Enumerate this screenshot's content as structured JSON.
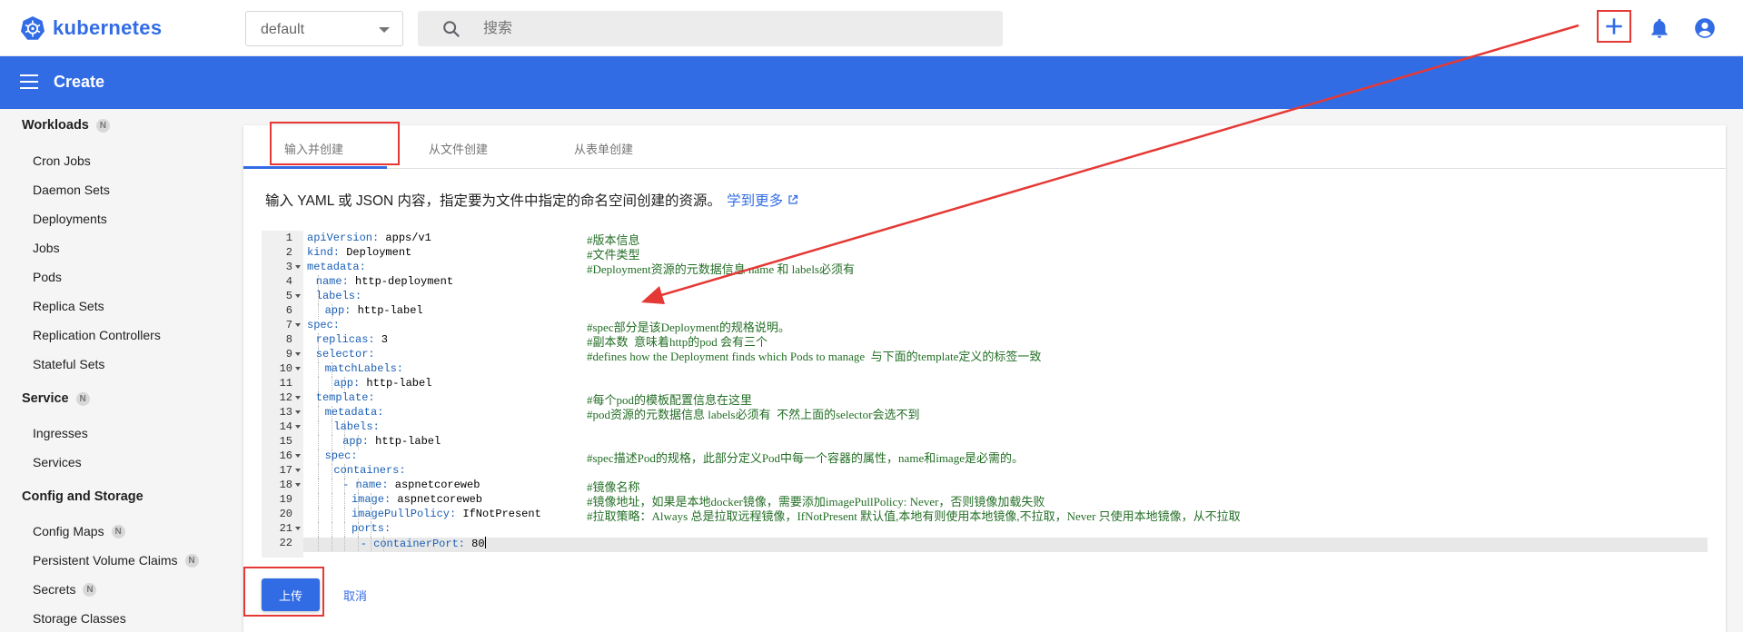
{
  "app": {
    "brand": "kubernetes",
    "accent": "#326ce5",
    "annotation_color": "#e53935"
  },
  "namespace": {
    "value": "default"
  },
  "search": {
    "placeholder": "搜索"
  },
  "toolbar": {
    "create_icon": "plus-icon",
    "notifications_icon": "bell-icon",
    "account_icon": "account-circle-icon"
  },
  "header": {
    "title": "Create"
  },
  "sidebar": {
    "sections": [
      {
        "label": "Workloads",
        "badge": "N",
        "items": [
          {
            "label": "Cron Jobs"
          },
          {
            "label": "Daemon Sets"
          },
          {
            "label": "Deployments"
          },
          {
            "label": "Jobs"
          },
          {
            "label": "Pods"
          },
          {
            "label": "Replica Sets"
          },
          {
            "label": "Replication Controllers"
          },
          {
            "label": "Stateful Sets"
          }
        ]
      },
      {
        "label": "Service",
        "badge": "N",
        "items": [
          {
            "label": "Ingresses"
          },
          {
            "label": "Services"
          }
        ]
      },
      {
        "label": "Config and Storage",
        "items": [
          {
            "label": "Config Maps",
            "badge": "N"
          },
          {
            "label": "Persistent Volume Claims",
            "badge": "N"
          },
          {
            "label": "Secrets",
            "badge": "N"
          },
          {
            "label": "Storage Classes"
          }
        ]
      }
    ]
  },
  "tabs": [
    {
      "label": "输入并创建",
      "active": true
    },
    {
      "label": "从文件创建"
    },
    {
      "label": "从表单创建"
    }
  ],
  "description": {
    "text": "输入 YAML 或 JSON 内容，指定要为文件中指定的命名空间创建的资源。",
    "link": "学到更多"
  },
  "editor": {
    "lines": [
      {
        "n": "1",
        "key": "apiVersion:",
        "val": " apps/v1",
        "comment": "#版本信息"
      },
      {
        "n": "2",
        "key": "kind:",
        "val": " Deployment",
        "comment": "#文件类型"
      },
      {
        "n": "3",
        "key": "metadata:",
        "val": "",
        "comment": "#Deployment资源的元数据信息 name 和 labels必须有"
      },
      {
        "n": "4",
        "key": "name:",
        "val": " http-deployment",
        "comment": ""
      },
      {
        "n": "5",
        "key": "labels:",
        "val": "",
        "comment": ""
      },
      {
        "n": "6",
        "key": "app:",
        "val": " http-label",
        "comment": ""
      },
      {
        "n": "7",
        "key": "spec:",
        "val": "",
        "comment": "#spec部分是该Deployment的规格说明。"
      },
      {
        "n": "8",
        "key": "replicas:",
        "val": " 3",
        "comment": "#副本数  意味着http的pod 会有三个"
      },
      {
        "n": "9",
        "key": "selector:",
        "val": "",
        "comment": "#defines how the Deployment finds which Pods to manage  与下面的template定义的标签一致"
      },
      {
        "n": "10",
        "key": "matchLabels:",
        "val": "",
        "comment": ""
      },
      {
        "n": "11",
        "key": "app:",
        "val": " http-label",
        "comment": ""
      },
      {
        "n": "12",
        "key": "template:",
        "val": "",
        "comment": "#每个pod的模板配置信息在这里"
      },
      {
        "n": "13",
        "key": "metadata:",
        "val": "",
        "comment": "#pod资源的元数据信息 labels必须有  不然上面的selector会选不到"
      },
      {
        "n": "14",
        "key": "labels:",
        "val": "",
        "comment": ""
      },
      {
        "n": "15",
        "key": "app:",
        "val": " http-label",
        "comment": ""
      },
      {
        "n": "16",
        "key": "spec:",
        "val": "",
        "comment": "#spec描述Pod的规格，此部分定义Pod中每一个容器的属性，name和image是必需的。"
      },
      {
        "n": "17",
        "key": "containers:",
        "val": "",
        "comment": ""
      },
      {
        "n": "18",
        "key": "- name:",
        "val": " aspnetcoreweb",
        "comment": "#镜像名称"
      },
      {
        "n": "19",
        "key": "image:",
        "val": " aspnetcoreweb",
        "comment": "#镜像地址，如果是本地docker镜像，需要添加imagePullPolicy: Never，否则镜像加载失败"
      },
      {
        "n": "20",
        "key": "imagePullPolicy:",
        "val": " IfNotPresent",
        "comment": "#拉取策略：Always 总是拉取远程镜像，IfNotPresent 默认值,本地有则使用本地镜像,不拉取，Never 只使用本地镜像，从不拉取"
      },
      {
        "n": "21",
        "key": "ports:",
        "val": "",
        "comment": ""
      },
      {
        "n": "22",
        "key": "- containerPort:",
        "val": " 80",
        "comment": ""
      }
    ]
  },
  "actions": {
    "upload": "上传",
    "cancel": "取消"
  }
}
